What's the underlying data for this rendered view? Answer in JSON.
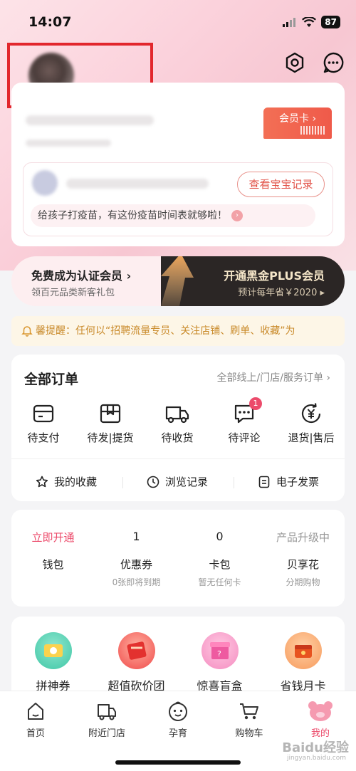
{
  "status_bar": {
    "time": "14:07",
    "battery": "87"
  },
  "vip_card": {
    "label": "会员卡 ›"
  },
  "baby": {
    "view_record_button": "查看宝宝记录",
    "vaccine_tip": "给孩子打疫苗，有这份疫苗时间表就够啦！"
  },
  "member_banner": {
    "left_title": "免费成为认证会员 ›",
    "left_sub": "领百元品类新客礼包",
    "right_title": "开通黑金PLUS会员",
    "right_sub": "预计每年省￥2020 ▸"
  },
  "notice": {
    "text": "馨提醒：任何以“招聘流量专员、关注店铺、刷单、收藏”为"
  },
  "orders": {
    "title": "全部订单",
    "link": "全部线上/门店/服务订单  ›",
    "items": [
      {
        "label": "待支付",
        "icon": "wallet-card-icon"
      },
      {
        "label": "待发|提货",
        "icon": "package-icon"
      },
      {
        "label": "待收货",
        "icon": "truck-icon"
      },
      {
        "label": "待评论",
        "icon": "comment-icon",
        "badge": "1"
      },
      {
        "label": "退货|售后",
        "icon": "refund-icon"
      }
    ],
    "quick": [
      {
        "label": "我的收藏",
        "icon": "star-icon"
      },
      {
        "label": "浏览记录",
        "icon": "clock-icon"
      },
      {
        "label": "电子发票",
        "icon": "invoice-icon"
      }
    ]
  },
  "wallet": {
    "items": [
      {
        "top": "立即开通",
        "label": "钱包",
        "sub": ""
      },
      {
        "top": "1",
        "label": "优惠券",
        "sub": "0张即将到期"
      },
      {
        "top": "0",
        "label": "卡包",
        "sub": "暂无任何卡"
      },
      {
        "top": "产品升级中",
        "label": "贝享花",
        "sub": "分期购物"
      }
    ]
  },
  "services": {
    "items": [
      {
        "label": "拼神券",
        "icon": "coupon-icon",
        "color": "#3fc7a6"
      },
      {
        "label": "超值砍价团",
        "icon": "bargain-icon",
        "color": "#f04a4a"
      },
      {
        "label": "惊喜盲盒",
        "icon": "blind-box-icon",
        "color": "#f065a0"
      },
      {
        "label": "省钱月卡",
        "icon": "monthly-card-icon",
        "color": "#f26b2a"
      }
    ]
  },
  "tabbar": {
    "items": [
      {
        "label": "首页",
        "icon": "home-icon"
      },
      {
        "label": "附近门店",
        "icon": "store-icon"
      },
      {
        "label": "孕育",
        "icon": "baby-face-icon"
      },
      {
        "label": "购物车",
        "icon": "cart-icon"
      },
      {
        "label": "我的",
        "icon": "me-icon",
        "active": true
      }
    ]
  },
  "watermark": {
    "text": "Baidu经验",
    "sub": "jingyan.baidu.com"
  },
  "colors": {
    "accent": "#ec4b6b",
    "highlight_box": "#e2272d"
  }
}
